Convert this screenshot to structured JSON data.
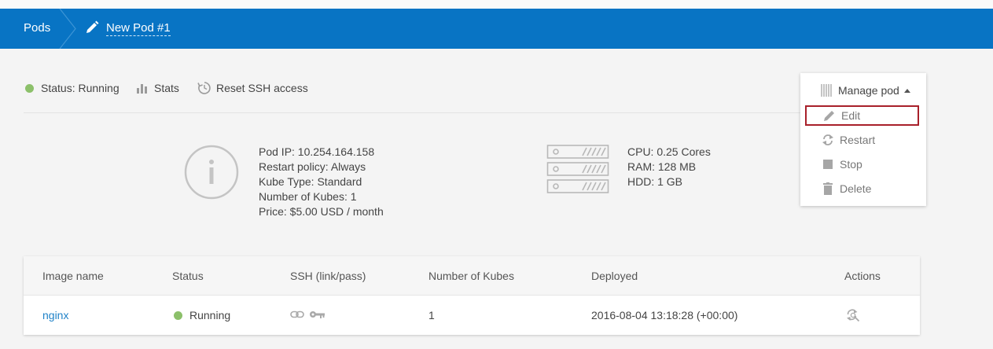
{
  "header": {
    "breadcrumb_root": "Pods",
    "pod_title": "New Pod #1"
  },
  "statusbar": {
    "status_label": "Status: Running",
    "stats_label": "Stats",
    "reset_ssh_label": "Reset SSH access"
  },
  "pod_info": {
    "ip": "Pod IP: 10.254.164.158",
    "restart_policy": "Restart policy: Always",
    "kube_type": "Kube Type: Standard",
    "kubes": "Number of Kubes: 1",
    "price": "Price: $5.00 USD / month"
  },
  "resources": {
    "cpu": "CPU: 0.25 Cores",
    "ram": "RAM: 128 MB",
    "hdd": "HDD: 1 GB"
  },
  "manage_menu": {
    "title": "Manage pod",
    "items": [
      {
        "label": "Edit",
        "icon": "pencil-icon",
        "selected": true
      },
      {
        "label": "Restart",
        "icon": "restart-icon"
      },
      {
        "label": "Stop",
        "icon": "stop-icon"
      },
      {
        "label": "Delete",
        "icon": "trash-icon"
      }
    ]
  },
  "table": {
    "columns": [
      "Image name",
      "Status",
      "SSH (link/pass)",
      "Number of Kubes",
      "Deployed",
      "Actions"
    ],
    "rows": [
      {
        "image_name": "nginx",
        "status": "Running",
        "kubes": "1",
        "deployed": "2016-08-04 13:18:28 (+00:00)"
      }
    ]
  },
  "colors": {
    "header_bg": "#0874c4",
    "running_dot": "#8cc06a",
    "link": "#1f82c8",
    "selected_outline": "#a8202a"
  }
}
